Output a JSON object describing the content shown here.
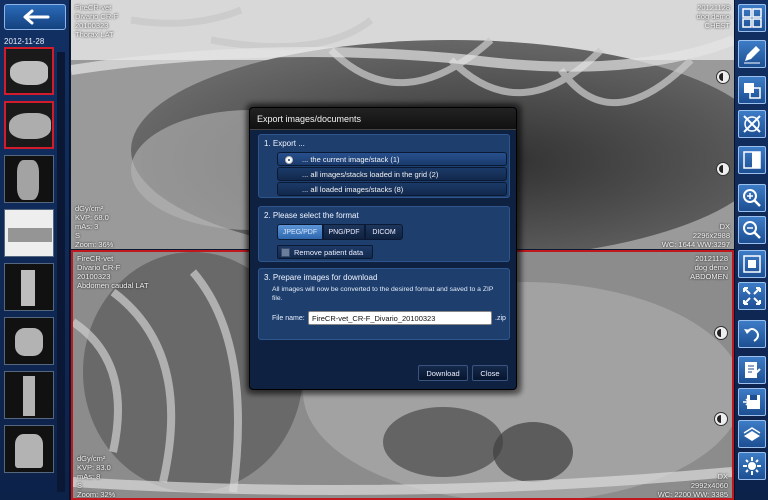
{
  "sidebar": {
    "date": "2012-11-28",
    "thumbnails": [
      {
        "label": "thumb-1",
        "selected": true
      },
      {
        "label": "thumb-2",
        "selected": true
      },
      {
        "label": "thumb-3",
        "selected": false
      },
      {
        "label": "thumb-4",
        "selected": false
      },
      {
        "label": "thumb-5",
        "selected": false
      },
      {
        "label": "thumb-6",
        "selected": false
      },
      {
        "label": "thumb-7",
        "selected": false
      },
      {
        "label": "thumb-8",
        "selected": false
      }
    ]
  },
  "viewport_top": {
    "info_top_left": "FireCR-vet\nDivario CR-F\n20100323\nThorax LAT",
    "info_top_right": "20121128\ndog demo\nCHEST",
    "info_bottom_left": "dGy/cm²\nKVP: 68.0\nmAs: 3\nS\nZoom: 36%",
    "info_bottom_right": "DX\n2296x2988\nWC: 1644 WW:3297"
  },
  "viewport_bottom": {
    "info_top_left": "FireCR-vet\nDivario CR-F\n20100323\nAbdomen caudal LAT",
    "info_top_right": "20121128\ndog demo\nABDOMEN",
    "info_bottom_left": "dGy/cm²\nKVP: 83.0\nmAs: 8\nS\nZoom: 32%",
    "info_bottom_right": "DX\n2992x4060\nWC: 2200 WW: 3385"
  },
  "dialog": {
    "title": "Export images/documents",
    "section1_title": "1. Export ...",
    "options": [
      "... the current image/stack (1)",
      "... all images/stacks loaded in the grid (2)",
      "... all loaded images/stacks (8)"
    ],
    "section2_title": "2. Please select the format",
    "formats": [
      "JPEG/PDF",
      "PNG/PDF",
      "DICOM"
    ],
    "remove_patient_data": "Remove patient data",
    "section3_title": "3. Prepare images for download",
    "note": "All images will now be converted to the desired format and saved to a ZIP file.",
    "file_name_label": "File name:",
    "file_name_value": "FireCR-vet_CR-F_Divario_20100323",
    "zip_ext": ".zip",
    "download_label": "Download",
    "close_label": "Close"
  },
  "toolbar_icons": [
    "grid-layout-icon",
    "pen-annotate-icon",
    "compare-icon",
    "rotate-flip-icon",
    "invert-icon",
    "zoom-in-icon",
    "zoom-out-icon",
    "fit-screen-icon",
    "expand-icon",
    "undo-icon",
    "report-icon",
    "save-export-icon",
    "print-icon",
    "settings-icon"
  ]
}
